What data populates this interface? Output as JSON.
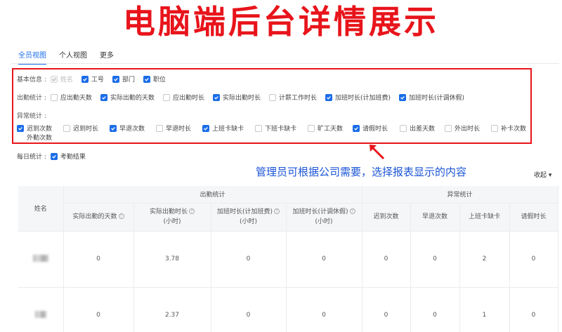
{
  "banner": {
    "title": "电脑端后台详情展示"
  },
  "tabs": [
    {
      "label": "全员视图",
      "active": true
    },
    {
      "label": "个人视图",
      "active": false
    },
    {
      "label": "更多",
      "active": false
    }
  ],
  "filters": {
    "basic": {
      "label": "基本信息 :",
      "items": [
        {
          "label": "姓名",
          "checked": true,
          "disabled": true
        },
        {
          "label": "工号",
          "checked": true
        },
        {
          "label": "部门",
          "checked": true
        },
        {
          "label": "职位",
          "checked": true
        }
      ]
    },
    "attendance": {
      "label": "出勤统计 :",
      "items": [
        {
          "label": "应出勤天数",
          "checked": false
        },
        {
          "label": "实际出勤的天数",
          "checked": true
        },
        {
          "label": "应出勤时长",
          "checked": false
        },
        {
          "label": "实际出勤时长",
          "checked": true
        },
        {
          "label": "计薪工作时长",
          "checked": false
        },
        {
          "label": "加班时长(计加班费)",
          "checked": true
        },
        {
          "label": "加班时长(计调休假)",
          "checked": true
        }
      ]
    },
    "abnormal": {
      "label": "异常统计 :",
      "items": [
        {
          "label": "迟到次数",
          "checked": true
        },
        {
          "label": "迟到时长",
          "checked": false
        },
        {
          "label": "早退次数",
          "checked": true
        },
        {
          "label": "早退时长",
          "checked": false
        },
        {
          "label": "上班卡缺卡",
          "checked": true
        },
        {
          "label": "下班卡缺卡",
          "checked": false
        },
        {
          "label": "旷工天数",
          "checked": false
        },
        {
          "label": "请假时长",
          "checked": true
        },
        {
          "label": "出差天数",
          "checked": false
        },
        {
          "label": "外出时长",
          "checked": false
        },
        {
          "label": "补卡次数",
          "checked": false
        },
        {
          "label": "外勤次数",
          "checked": false
        }
      ]
    }
  },
  "daily": {
    "label": "每日统计 :",
    "item": "考勤结果",
    "checked": true
  },
  "annotation": {
    "text": "管理员可根据公司需要，选择报表显示的内容"
  },
  "collapse": {
    "label": "收起 ▾"
  },
  "table": {
    "name_header": "姓名",
    "group_headers": [
      "出勤统计",
      "异常统计"
    ],
    "columns": [
      {
        "label": "实际出勤的天数",
        "sub": "",
        "help": true
      },
      {
        "label": "实际出勤时长",
        "sub": "(小时)",
        "help": true
      },
      {
        "label": "加班时长(计加班费)",
        "sub": "(小时)",
        "help": true
      },
      {
        "label": "加班时长(计调休假)",
        "sub": "(小时)",
        "help": true
      },
      {
        "label": "迟到次数",
        "sub": "",
        "help": false
      },
      {
        "label": "早退次数",
        "sub": "",
        "help": false
      },
      {
        "label": "上班卡缺卡",
        "sub": "",
        "help": false
      },
      {
        "label": "请假时长",
        "sub": "",
        "help": false
      }
    ],
    "rows": [
      {
        "values": [
          "0",
          "3.78",
          "0",
          "0",
          "0",
          "0",
          "2",
          "0"
        ]
      },
      {
        "values": [
          "0",
          "2.37",
          "0",
          "0",
          "0",
          "0",
          "1",
          "0"
        ]
      }
    ]
  },
  "colors": {
    "accent": "#1b6de8",
    "highlight": "#e8141b",
    "note": "#1b55d6"
  }
}
